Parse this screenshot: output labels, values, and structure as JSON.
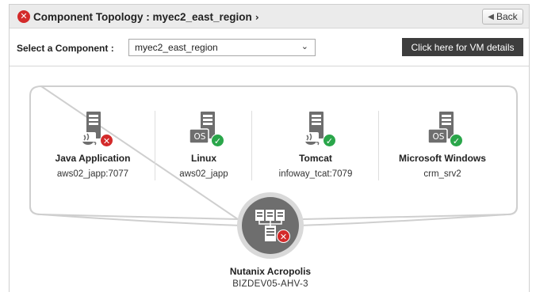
{
  "header": {
    "title": "Component Topology : myec2_east_region",
    "title_chevron": "›",
    "close_glyph": "✕",
    "back_label": "Back",
    "back_glyph": "◀"
  },
  "selector": {
    "label": "Select a Component :",
    "value": "myec2_east_region",
    "caret": "⌄",
    "vm_button_label": "Click here for VM details"
  },
  "components": [
    {
      "name": "Java Application",
      "host": "aws02_japp:7077",
      "icon": "java-server-icon",
      "status": "error"
    },
    {
      "name": "Linux",
      "host": "aws02_japp",
      "icon": "os-server-icon",
      "status": "ok"
    },
    {
      "name": "Tomcat",
      "host": "infoway_tcat:7079",
      "icon": "java-server-icon",
      "status": "ok"
    },
    {
      "name": "Microsoft Windows",
      "host": "crm_srv2",
      "icon": "os-server-icon",
      "status": "ok"
    }
  ],
  "os_label": "OS",
  "hub": {
    "name": "Nutanix Acropolis",
    "host": "BIZDEV05-AHV-3",
    "icon": "hypervisor-icon",
    "status": "error"
  },
  "status_glyphs": {
    "ok": "✓",
    "error": "✕"
  },
  "colors": {
    "ok": "#2aa64a",
    "error": "#d32a2a",
    "button_dark": "#3d3d3d",
    "icon_gray": "#6e6e6e"
  }
}
